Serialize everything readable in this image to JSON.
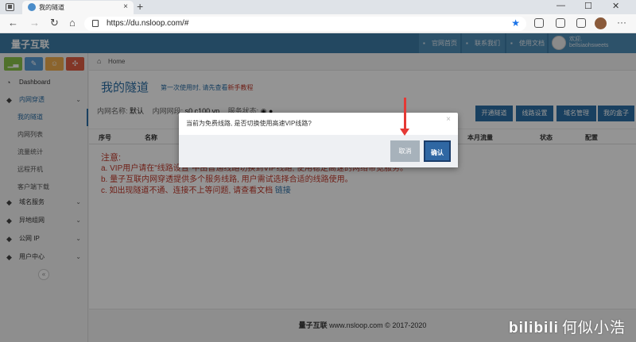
{
  "browser": {
    "tab_title": "我的隧道",
    "new_tab": "+",
    "tab_close": "×",
    "url": "https://du.nsloop.com/#",
    "min": "—",
    "max": "☐",
    "close": "✕"
  },
  "header": {
    "logo": "量子互联",
    "buttons": [
      "官网首页",
      "联系我们",
      "使用文档"
    ],
    "user_greeting": "欢迎,",
    "user_name": "bellsiaohsweets"
  },
  "sidebar": {
    "colors": [
      "#8bc34a",
      "#5b9bd5",
      "#f0ad4e",
      "#e05d44"
    ],
    "dashboard": "Dashboard",
    "group1": "内网穿透",
    "group1_items": [
      "我的隧道",
      "内网列表",
      "流量统计",
      "远程开机",
      "客户端下载"
    ],
    "groups": [
      "域名服务",
      "异地组网",
      "公网 IP",
      "用户中心"
    ]
  },
  "main": {
    "breadcrumb": "Home",
    "title": "我的隧道",
    "tip_prefix": "第一次使用时, 请先查看",
    "tip_link": "新手教程",
    "info_name_label": "内网名称:",
    "info_name_value": "默认",
    "info_ip_label": "内网网段:",
    "info_ip_value": "s0.c100.vp",
    "info_svc_label": "服务状态:",
    "info_svc_value": "◉ ●",
    "actions": [
      "开通隧道",
      "线路设置",
      "域名管理",
      "我的盒子"
    ],
    "columns": [
      "序号",
      "名称",
      "本月流量",
      "状态",
      "配置"
    ],
    "notice_head": "注意:",
    "notice_a": "a. VIP用户请在\"线路设置\"中由普通线路切换到VIP线路, 使用稳定高速的网络带宽服务。",
    "notice_b": "b. 量子互联内网穿透提供多个服务线路, 用户需试选择合适的线路使用。",
    "notice_c": "c. 如出现隧道不通、连接不上等问题, 请查看文档",
    "notice_c_link": "链接",
    "footer_brand": "量子互联",
    "footer_text": "www.nsloop.com © 2017-2020"
  },
  "modal": {
    "message": "当前为免费线路, 是否切换使用高速VIP线路?",
    "cancel": "取消",
    "ok": "确认"
  },
  "watermark": {
    "brand": "bilibili",
    "user": "何似小浩"
  }
}
